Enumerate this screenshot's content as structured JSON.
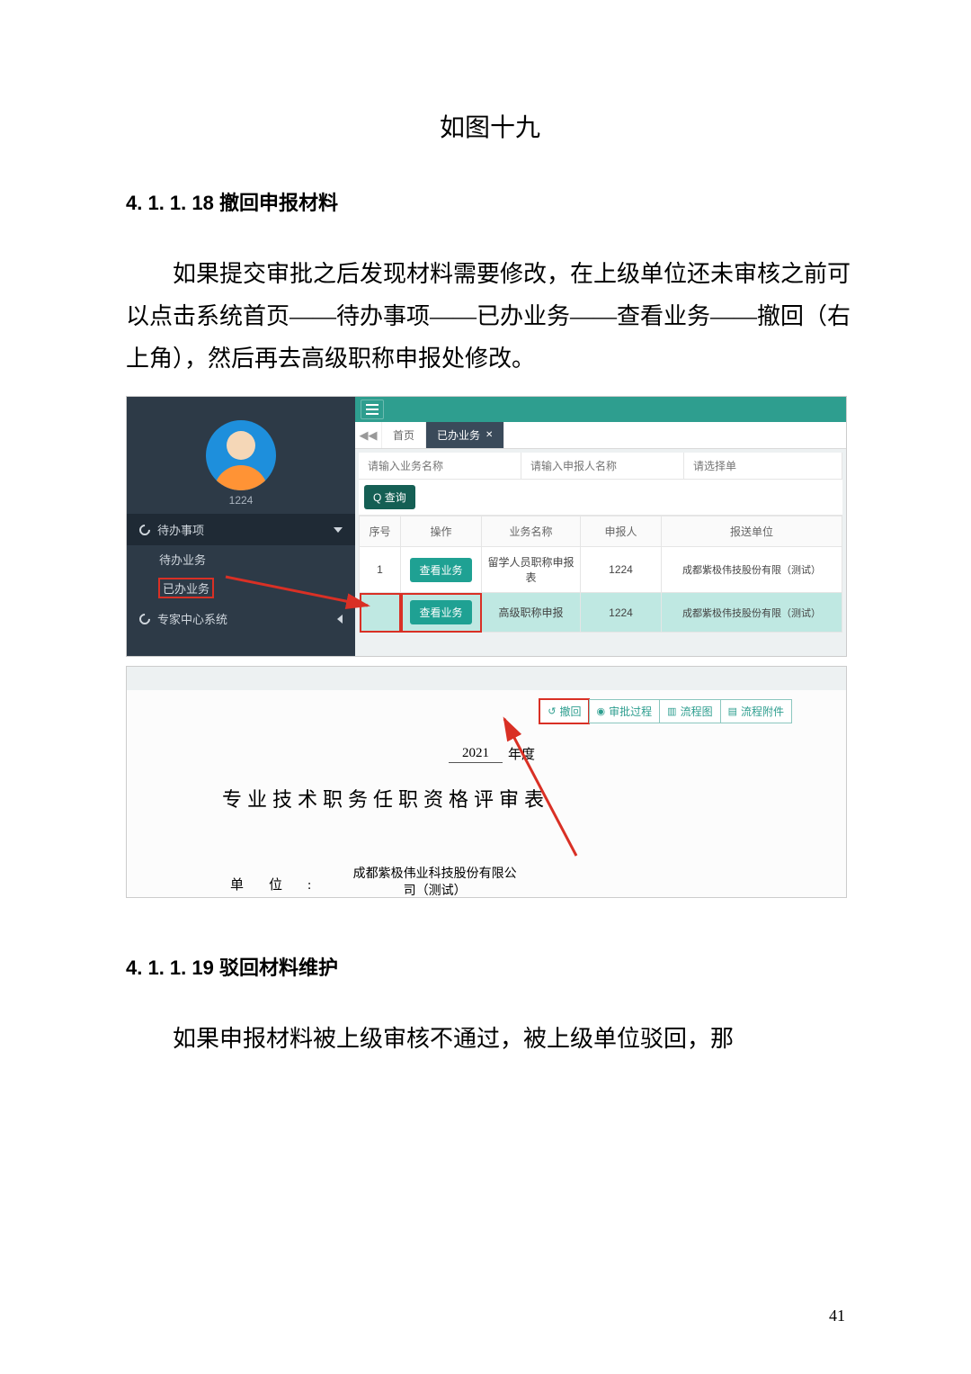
{
  "doc": {
    "fig_caption": "如图十九",
    "section_18": "4. 1. 1. 18 撤回申报材料",
    "p1": "如果提交审批之后发现材料需要修改，在上级单位还未审核之前可以点击系统首页——待办事项——已办业务——查看业务——撤回（右上角），然后再去高级职称申报处修改。",
    "section_19": "4. 1. 1. 19 驳回材料维护",
    "p2": "如果申报材料被上级审核不通过，被上级单位驳回，那",
    "page_num": "41"
  },
  "app": {
    "username": "1224",
    "nav": {
      "pending_label": "待办事项",
      "pending_sub": "待办业务",
      "done_sub": "已办业务",
      "expert_label": "专家中心系统"
    },
    "tabs": {
      "home": "首页",
      "done": "已办业务"
    },
    "filters": {
      "biz_placeholder": "请输入业务名称",
      "person_placeholder": "请输入申报人名称",
      "unit_placeholder": "请选择单"
    },
    "query_label": "查询",
    "table": {
      "headers": {
        "idx": "序号",
        "op": "操作",
        "name": "业务名称",
        "person": "申报人",
        "unit": "报送单位"
      },
      "view_label": "查看业务",
      "rows": [
        {
          "idx": "1",
          "name": "留学人员职称申报表",
          "person": "1224",
          "unit": "成都紫极伟技股份有限（测试）"
        },
        {
          "idx": "",
          "name": "高级职称申报",
          "person": "1224",
          "unit": "成都紫极伟技股份有限（测试）"
        }
      ]
    }
  },
  "detail": {
    "toolbar": {
      "recall": "撤回",
      "approval": "审批过程",
      "flowchart": "流程图",
      "attach": "流程附件"
    },
    "year": "2021",
    "year_suffix": "年度",
    "form_title": "专业技术职务任职资格评审表",
    "unit_label": "单位:",
    "unit_value": "成都紫极伟业科技股份有限公司（测试）"
  }
}
